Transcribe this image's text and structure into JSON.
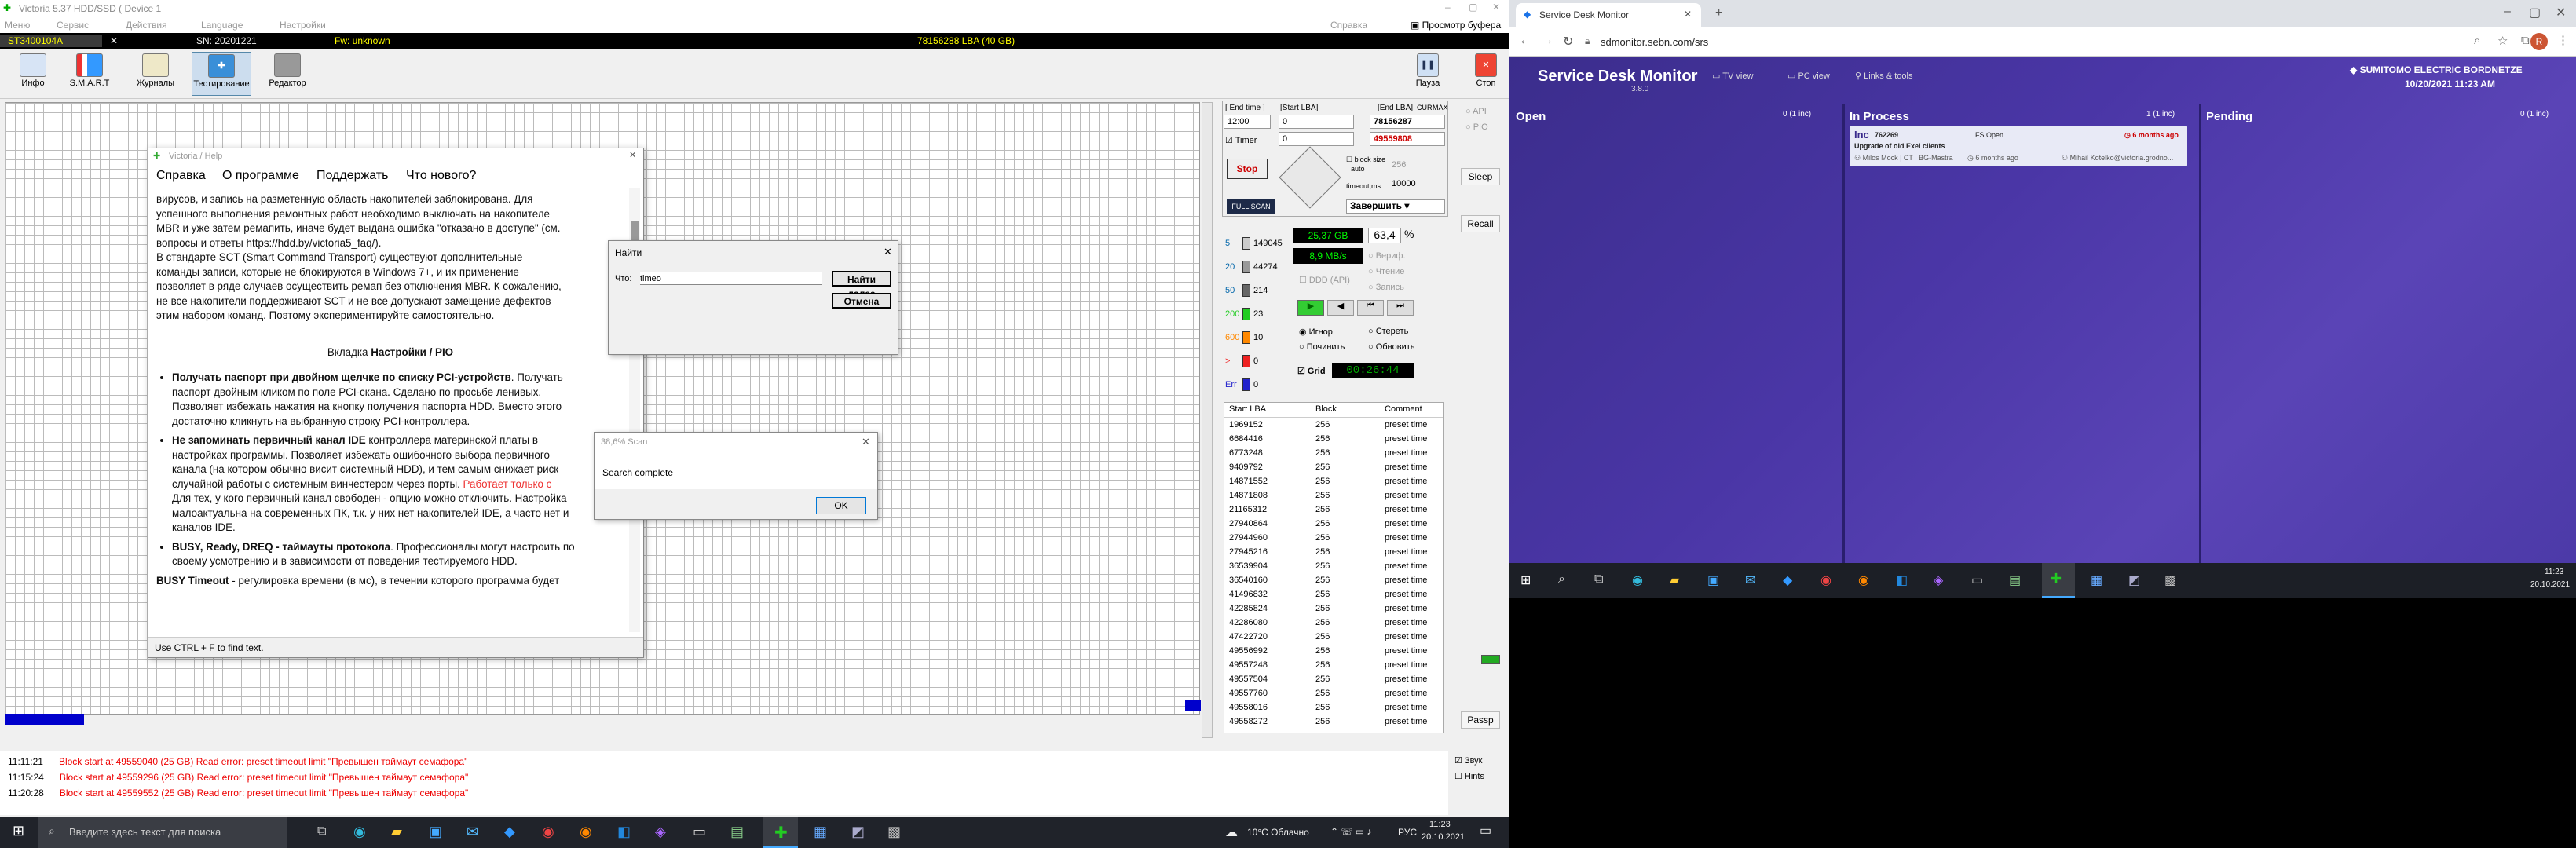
{
  "victoria": {
    "title": "Victoria 5.37 HDD/SSD ( Device 1",
    "menu": [
      "Меню",
      "Сервис",
      "Действия",
      "Language",
      "Настройки"
    ],
    "menu_right": [
      "Справка",
      "Просмотр буфера"
    ],
    "drive": "ST3400104A",
    "sn": "SN: 20201221",
    "fw": "Fw: unknown",
    "lba_total": "78156288 LBA (40 GB)",
    "toolbar": [
      "Инфо",
      "S.M.A.R.T",
      "Журналы",
      "Тестирование",
      "Редактор"
    ],
    "pause": "Пауза",
    "stop": "Стоп",
    "help": {
      "title": "Victoria / Help",
      "tabs": [
        "Справка",
        "О программе",
        "Поддержать",
        "Что нового?"
      ],
      "para1": [
        "вирусов, и запись на разметенную область накопителей заблокирована. Для",
        "успешного выполнения ремонтных работ необходимо выключать на накопителе",
        "MBR и уже затем ремапить, иначе будет выдана ошибка \"отказано в доступе\" (см.",
        "вопросы и ответы https://hdd.by/victoria5_faq/).",
        "В стандарте SCT (Smart Command Transport) существуют дополнительные",
        "команды записи, которые не блокируются в Windows 7+, и их применение",
        "позволяет в ряде случаев осуществить ремап без отключения MBR. К сожалению,",
        "не все накопители поддерживают SCT и не все допускают замещение дефектов",
        "этим набором команд. Поэтому экспериментируйте самостоятельно."
      ],
      "section_prefix": "Вкладка ",
      "section": "Настройки / PIO",
      "b1_bold": "Получать паспорт при двойном щелчке по списку PCI-устройств",
      "b1": [
        ". Получать",
        "паспорт двойным кликом по поле PCI-скана. Сделано по просьбе ленивых.",
        "Позволяет избежать нажатия на кнопку получения паспорта HDD. Вместо этого",
        "достаточно кликнуть на выбранную строку PCI-контроллера."
      ],
      "b2_bold": "Не запоминать первичный канал IDE",
      "b2": [
        " контроллера материнской платы в",
        "настройках программы. Позволяет избежать ошибочного выбора первичного",
        "канала (на котором обычно висит системный HDD), и тем самым снижает риск",
        "случайной работы с системным винчестером через порты. ",
        "Для тех, у кого первичный канал свободен - опцию можно отключить. Настройка",
        "малоактуальна на современных ПК, т.к. у них нет накопителей IDE, а часто нет и",
        "каналов IDE."
      ],
      "b2_red": "Работает только с",
      "b3_bold": "BUSY, Ready, DREQ - таймауты протокола",
      "b3": [
        ". Профессионалы могут настроить по",
        "своему усмотрению и в зависимости от поведения тестируемого HDD."
      ],
      "b4_bold": "BUSY Timeout",
      "b4": " - регулировка времени (в мс), в течении которого программа будет",
      "status": "Use CTRL + F to find text."
    },
    "find": {
      "title": "Найти",
      "label": "Что:",
      "value": "timeo",
      "next": "Найти далее",
      "cancel": "Отмена"
    },
    "scan": {
      "title": "38,6% Scan",
      "msg": "Search complete",
      "ok": "OK"
    },
    "panel": {
      "end_time": "[ End time ]",
      "start_lba": "[Start LBA]",
      "end_lba": "[End LBA]",
      "cur": "CUR",
      "max": "MAX",
      "time_val": "12:00",
      "start_val": "0",
      "end_val": "78156287",
      "cur_val": "0",
      "end2_val": "49559808",
      "timer": "Timer",
      "stop": "Stop",
      "block_size": "block size",
      "auto": "auto",
      "bs_val": "256",
      "timeout": "timeout,ms",
      "to_val": "10000",
      "finish": "Завершить",
      "fullscan": "FULL SCAN",
      "api": "API",
      "pio": "PIO",
      "sleep": "Sleep",
      "recall": "Recall",
      "passp": "Passp",
      "counts": [
        {
          "lbl": "5",
          "val": "149045"
        },
        {
          "lbl": "20",
          "val": "44274"
        },
        {
          "lbl": "50",
          "val": "214"
        },
        {
          "lbl": "200",
          "val": "23"
        },
        {
          "lbl": "600",
          "val": "10"
        },
        {
          "lbl": ">",
          "val": "0"
        },
        {
          "lbl": "Err",
          "val": "0"
        }
      ],
      "gb": "25,37 GB",
      "pct": "63,4",
      "pctsign": "%",
      "speed": "8,9 MB/s",
      "verify": "Вериф.",
      "read": "Чтение",
      "write": "Запись",
      "ddd": "DDD (API)",
      "ignore": "Игнор",
      "erase": "Стереть",
      "remap": "Починить",
      "refresh": "Обновить",
      "grid": "Grid",
      "timer_val": "00:26:44",
      "list_head": [
        "Start LBA",
        "Block",
        "Comment"
      ],
      "lba": [
        "1969152",
        "6684416",
        "6773248",
        "9409792",
        "14871552",
        "14871808",
        "21165312",
        "27940864",
        "27944960",
        "27945216",
        "36539904",
        "36540160",
        "41496832",
        "42285824",
        "42286080",
        "47422720",
        "49556992",
        "49557248",
        "49557504",
        "49557760",
        "49558016",
        "49558272"
      ],
      "block": "256",
      "comment": "preset time"
    },
    "log": [
      {
        "t": "11:11:21",
        "m": "Block start at 49559040 (25 GB) Read error: preset timeout limit \"Превышен таймаут семафора\""
      },
      {
        "t": "11:15:24",
        "m": "Block start at 49559296 (25 GB) Read error: preset timeout limit \"Превышен таймаут семафора\""
      },
      {
        "t": "11:20:28",
        "m": "Block start at 49559552 (25 GB) Read error: preset timeout limit \"Превышен таймаут семафора\""
      }
    ],
    "sound": "Звук",
    "hints": "Hints",
    "taskbar_search": "Введите здесь текст для поиска",
    "weather": "10°C  Облачно",
    "lang": "РУС",
    "clock_time": "11:23",
    "clock_date": "20.10.2021"
  },
  "chrome": {
    "tab": "Service Desk Monitor",
    "url": "sdmonitor.sebn.com/srs",
    "avatar": "R"
  },
  "sdm": {
    "app": "Service Desk Monitor",
    "version": "3.8.0",
    "nav": [
      "TV view",
      "PC view",
      "Links & tools"
    ],
    "brand": "SUMITOMO ELECTRIC BORDNETZE",
    "datetime": "10/20/2021 11:23 AM",
    "cols": [
      {
        "name": "Open",
        "count": "0 (1 inc)"
      },
      {
        "name": "In Process",
        "count": "1 (1 inc)"
      },
      {
        "name": "Pending",
        "count": "0 (1 inc)"
      }
    ],
    "card": {
      "type": "Inc",
      "id": "762269",
      "status": "FS Open",
      "age": "6 months ago",
      "title": "Upgrade of old Exel clients",
      "person1": "Milos Mock | CT | BG-Mastra",
      "ago": "6 months ago",
      "person2": "Mihail Kotelko@victoria.grodno..."
    },
    "clock_time": "11:23",
    "clock_date": "20.10.2021"
  }
}
